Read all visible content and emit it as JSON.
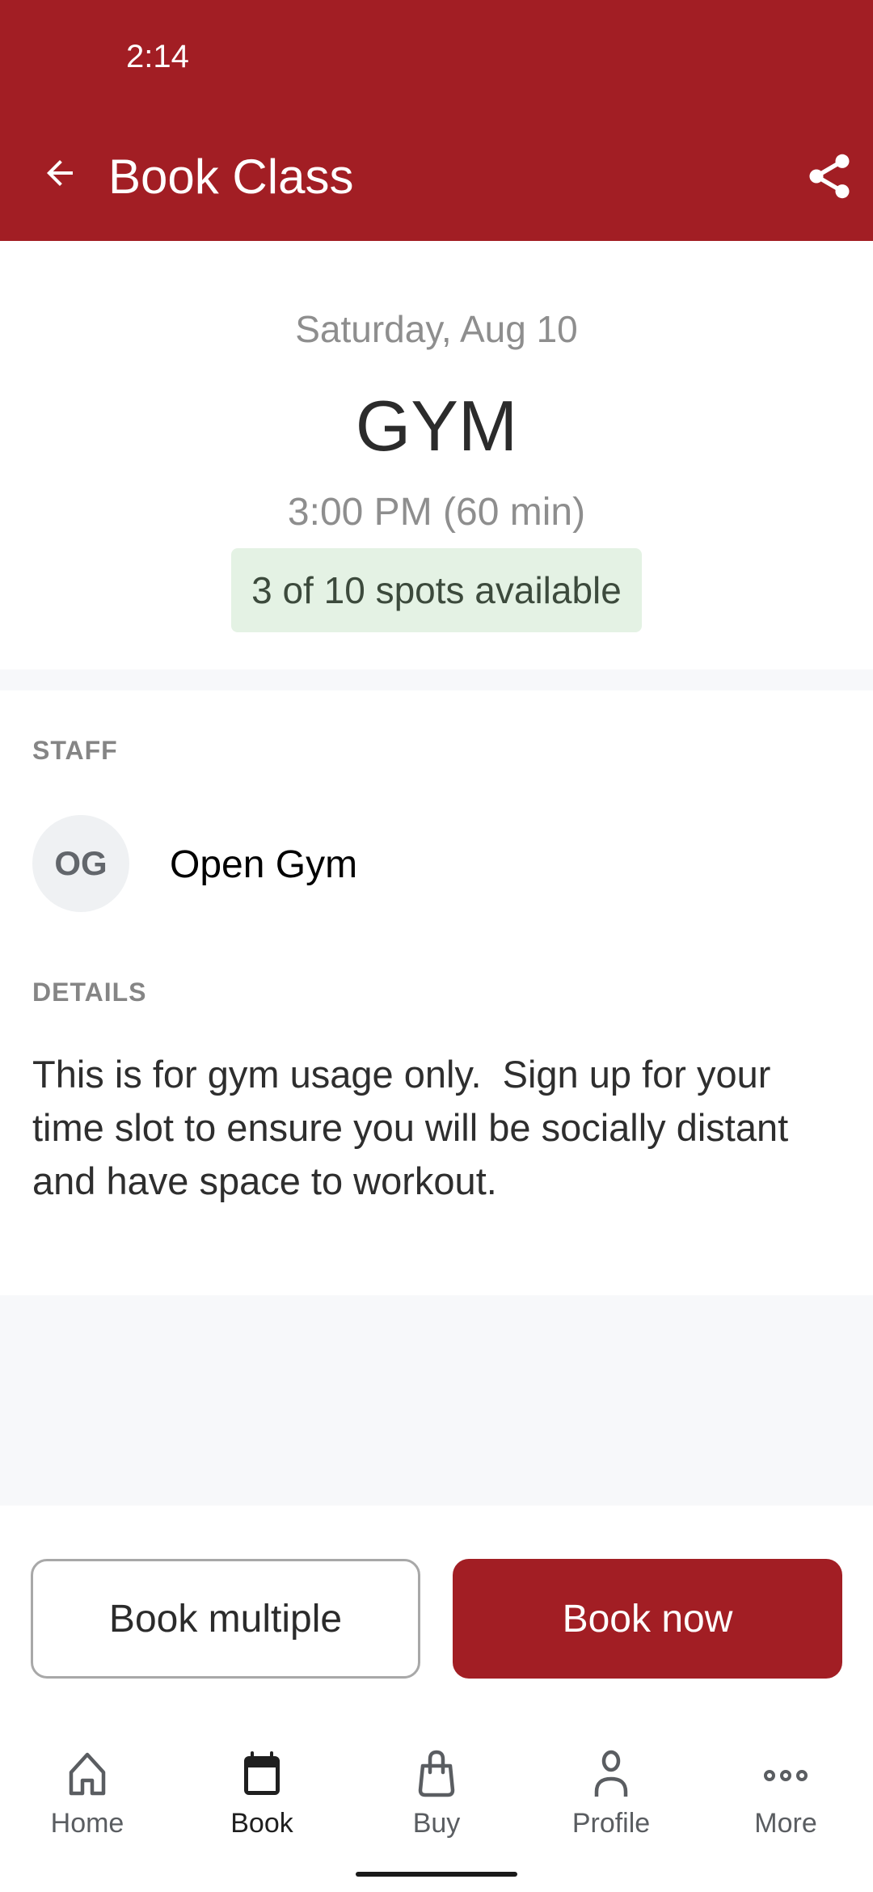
{
  "status_bar": {
    "time": "2:14"
  },
  "app_bar": {
    "title": "Book Class",
    "back_icon": "arrow-left-icon",
    "share_icon": "share-icon",
    "background_color": "#a21e24"
  },
  "class_info": {
    "date": "Saturday, Aug 10",
    "name": "GYM",
    "time": "3:00 PM (60 min)",
    "spots_badge": "3 of 10 spots available",
    "spots_available": 3,
    "spots_total": 10
  },
  "staff": {
    "label": "STAFF",
    "initials": "OG",
    "name": "Open Gym"
  },
  "details": {
    "label": "DETAILS",
    "text": "This is for gym usage only.  Sign up for your time slot to ensure you will be socially distant and have space to workout."
  },
  "actions": {
    "book_multiple": "Book multiple",
    "book_now": "Book now"
  },
  "tab_bar": {
    "items": [
      {
        "label": "Home",
        "icon": "home-icon",
        "active": false
      },
      {
        "label": "Book",
        "icon": "calendar-icon",
        "active": true
      },
      {
        "label": "Buy",
        "icon": "shopping-bag-icon",
        "active": false
      },
      {
        "label": "Profile",
        "icon": "person-icon",
        "active": false
      },
      {
        "label": "More",
        "icon": "more-horizontal-icon",
        "active": false
      }
    ]
  }
}
